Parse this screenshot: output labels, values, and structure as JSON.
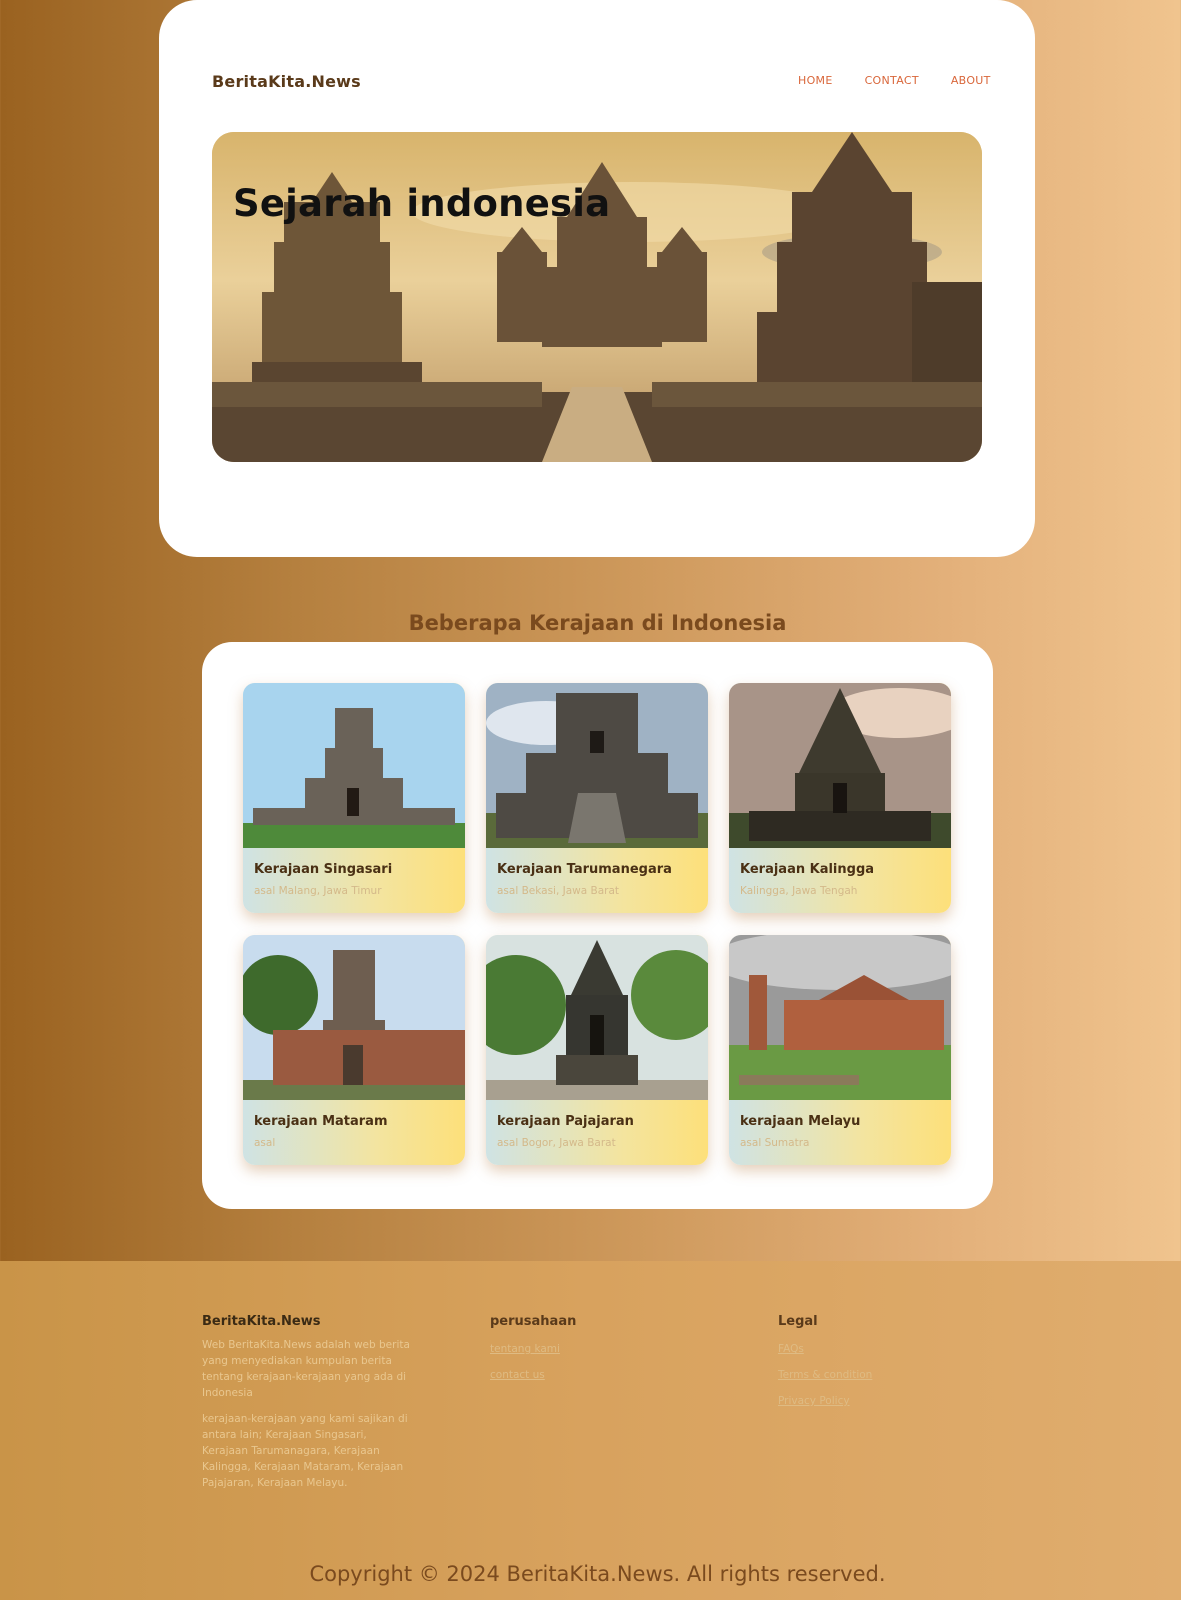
{
  "header": {
    "logo": "BeritaKita.News",
    "nav": [
      "HOME",
      "CONTACT",
      "ABOUT"
    ]
  },
  "hero": {
    "title": "Sejarah indonesia"
  },
  "section": {
    "title": "Beberapa Kerajaan di Indonesia",
    "cards": [
      {
        "title": "Kerajaan Singasari",
        "subtitle": "asal Malang, Jawa Timur"
      },
      {
        "title": "Kerajaan Tarumanegara",
        "subtitle": "asal Bekasi, Jawa Barat"
      },
      {
        "title": "Kerajaan Kalingga",
        "subtitle": "Kalingga, Jawa Tengah"
      },
      {
        "title": "kerajaan Mataram",
        "subtitle": "asal"
      },
      {
        "title": "kerajaan Pajajaran",
        "subtitle": "asal Bogor, Jawa Barat"
      },
      {
        "title": "kerajaan Melayu",
        "subtitle": "asal Sumatra"
      }
    ]
  },
  "footer": {
    "brand": "BeritaKita.News",
    "about_1": "Web BeritaKita.News adalah web berita yang menyediakan kumpulan berita tentang kerajaan-kerajaan yang ada di Indonesia",
    "about_2": "kerajaan-kerajaan yang kami sajikan di antara lain; Kerajaan Singasari, Kerajaan Tarumanagara, Kerajaan Kalingga, Kerajaan Mataram, Kerajaan Pajajaran, Kerajaan Melayu.",
    "company_head": "perusahaan",
    "company_links": [
      "tentang kami",
      "contact us"
    ],
    "legal_head": "Legal",
    "legal_links": [
      "FAQs",
      "Terms & condition",
      "Privacy Policy"
    ],
    "copyright": "Copyright © 2024 BeritaKita.News. All rights reserved."
  }
}
